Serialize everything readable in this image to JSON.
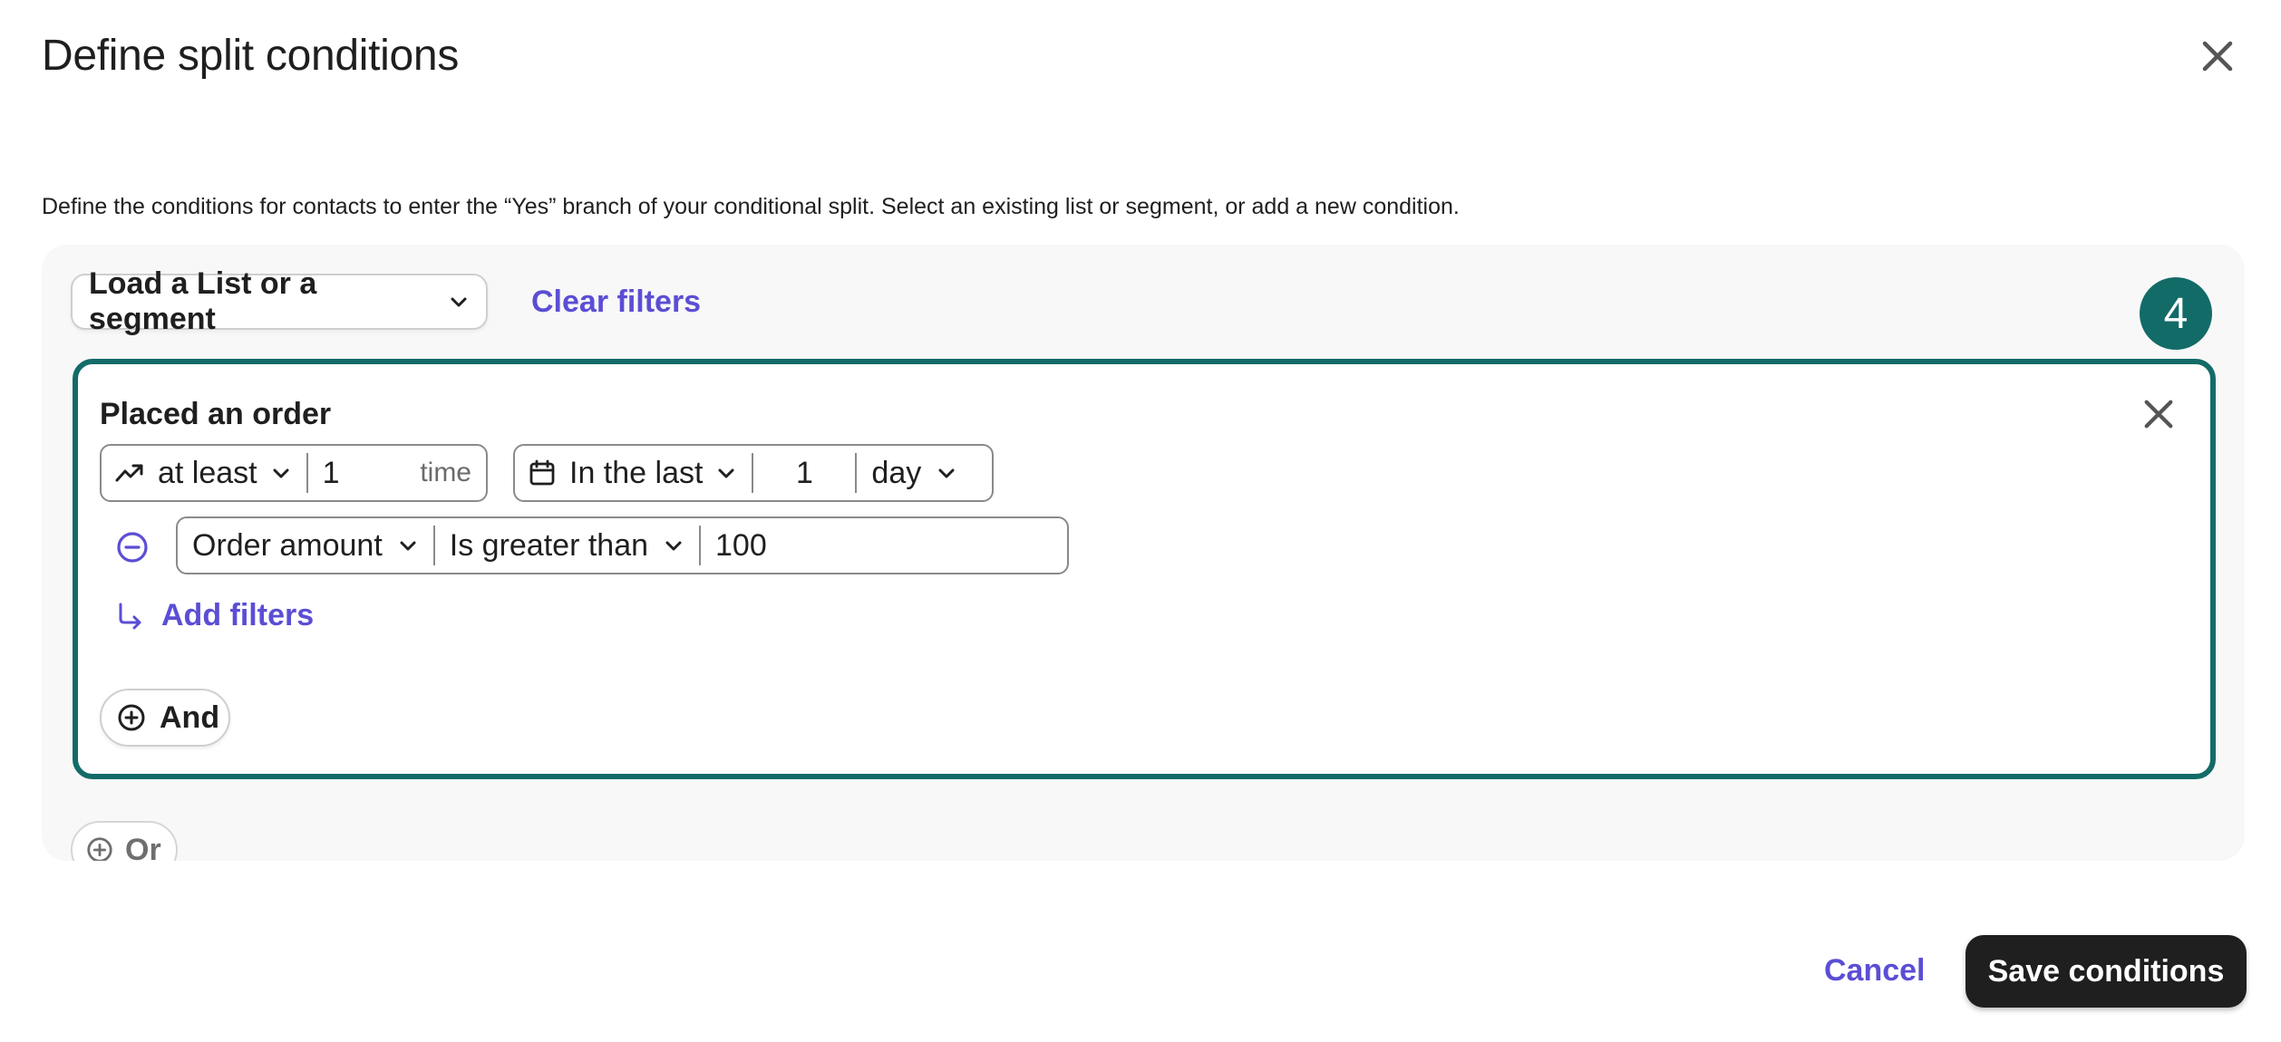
{
  "dialog": {
    "title": "Define split conditions",
    "description": "Define the conditions for contacts to enter the “Yes” branch of your conditional split. Select an existing list or segment, or add a new condition."
  },
  "toolbar": {
    "load_label": "Load a List or a segment",
    "clear_label": "Clear filters"
  },
  "badge": "4",
  "condition": {
    "title": "Placed an order",
    "frequency": {
      "operator": "at least",
      "value": "1",
      "unit": "time"
    },
    "timeframe": {
      "operator": "In the last",
      "value": "1",
      "unit": "day"
    },
    "filter": {
      "property": "Order amount",
      "operator": "Is greater than",
      "value": "100"
    },
    "add_filters_label": "Add filters",
    "and_label": "And"
  },
  "or_label": "Or",
  "footer": {
    "cancel_label": "Cancel",
    "save_label": "Save conditions"
  },
  "colors": {
    "accent": "#5b4ed4",
    "highlight": "#136b68",
    "primary_button": "#1f1f1f"
  }
}
